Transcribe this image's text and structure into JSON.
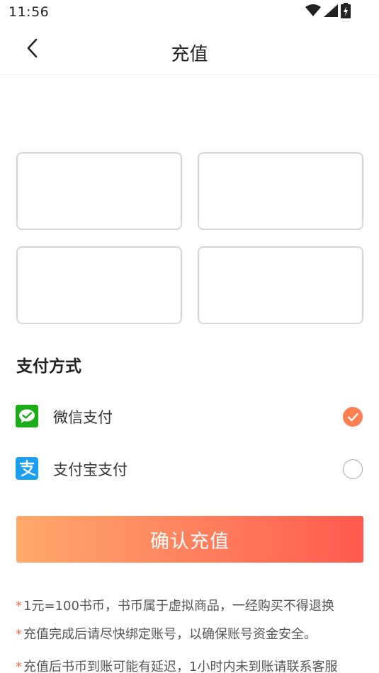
{
  "status_bar": {
    "time": "11:56",
    "icons": [
      "wifi-icon",
      "signal-icon",
      "battery-icon"
    ]
  },
  "header": {
    "title": "充值",
    "back_icon": "chevron-left-icon"
  },
  "recharge_options": [
    {
      "label": ""
    },
    {
      "label": ""
    },
    {
      "label": ""
    },
    {
      "label": ""
    }
  ],
  "payment": {
    "section_title": "支付方式",
    "methods": [
      {
        "label": "微信支付",
        "icon": "wechat-pay-icon",
        "selected": true,
        "icon_color": "#1aad19"
      },
      {
        "label": "支付宝支付",
        "icon": "alipay-icon",
        "selected": false,
        "icon_color": "#1d9ff0"
      }
    ]
  },
  "confirm_button": {
    "label": "确认充值"
  },
  "notes": {
    "star": "*",
    "items": [
      "1元=100书币，书币属于虚拟商品，一经购买不得退换",
      "充值完成后请尽快绑定账号，以确保账号资金安全。",
      "充值后书币到账可能有延迟，1小时内未到账请联系客服"
    ]
  },
  "colors": {
    "accent": "#ff7f50",
    "gradient_start": "#ffa96b",
    "gradient_end": "#ff5a4f",
    "note_star": "#ff6a4d"
  }
}
